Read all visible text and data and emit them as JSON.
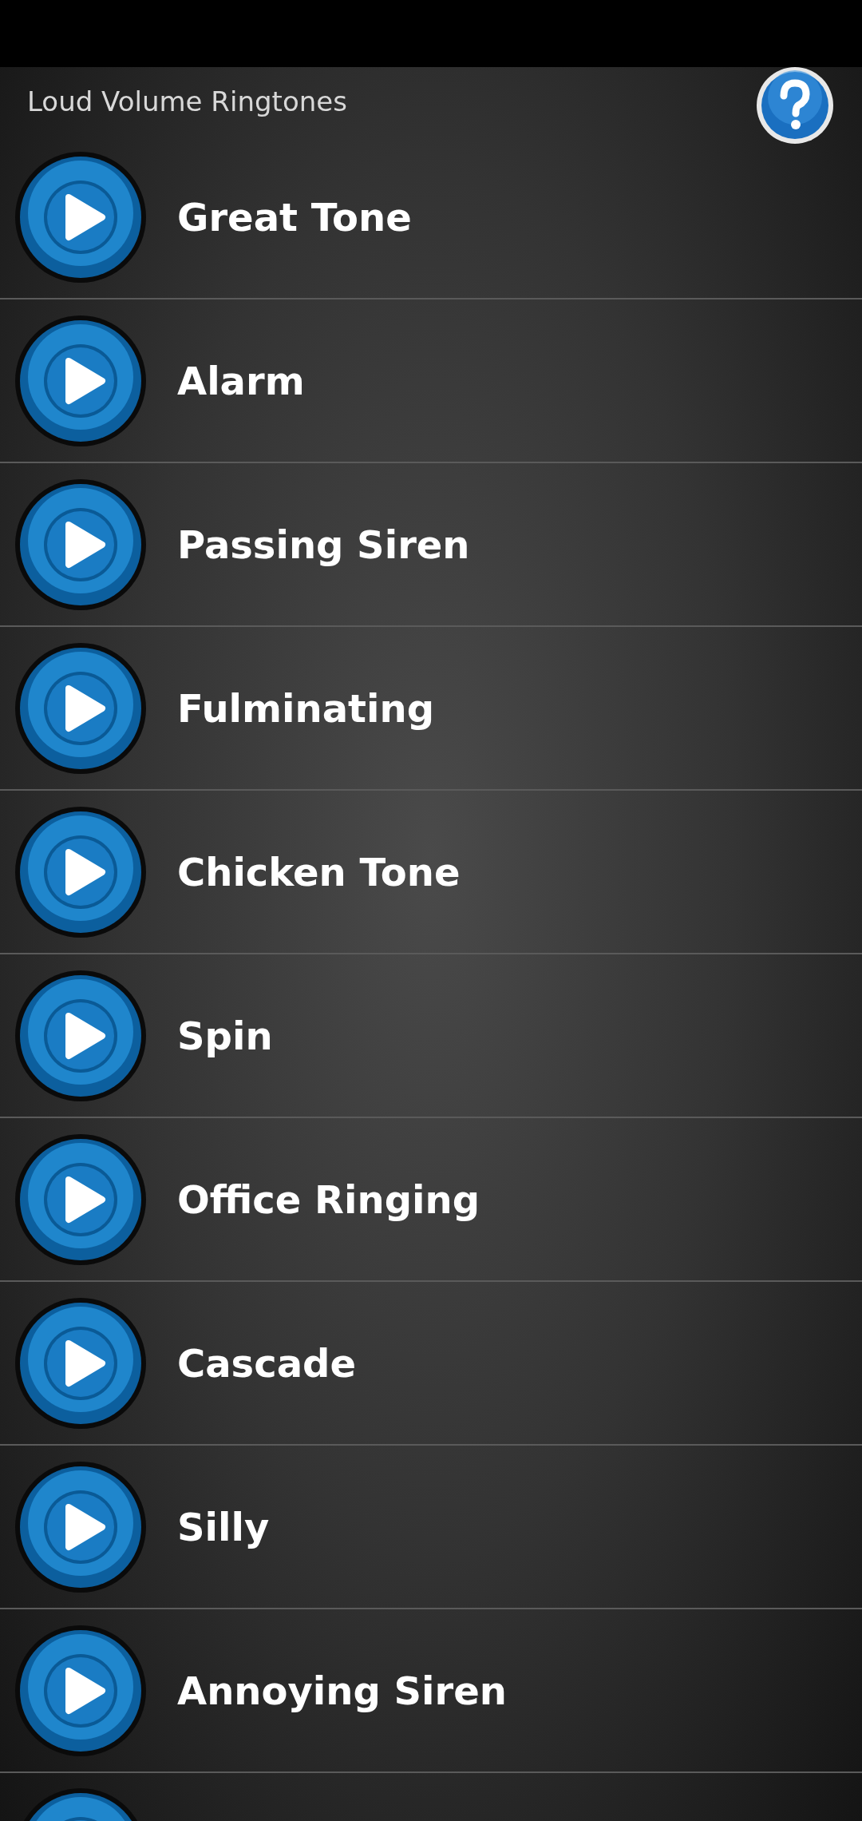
{
  "header": {
    "title": "Loud Volume Ringtones"
  },
  "ringtones": [
    {
      "title": "Great Tone"
    },
    {
      "title": "Alarm"
    },
    {
      "title": "Passing Siren"
    },
    {
      "title": "Fulminating"
    },
    {
      "title": "Chicken Tone"
    },
    {
      "title": "Spin"
    },
    {
      "title": "Office Ringing"
    },
    {
      "title": "Cascade"
    },
    {
      "title": "Silly"
    },
    {
      "title": "Annoying Siren"
    }
  ]
}
